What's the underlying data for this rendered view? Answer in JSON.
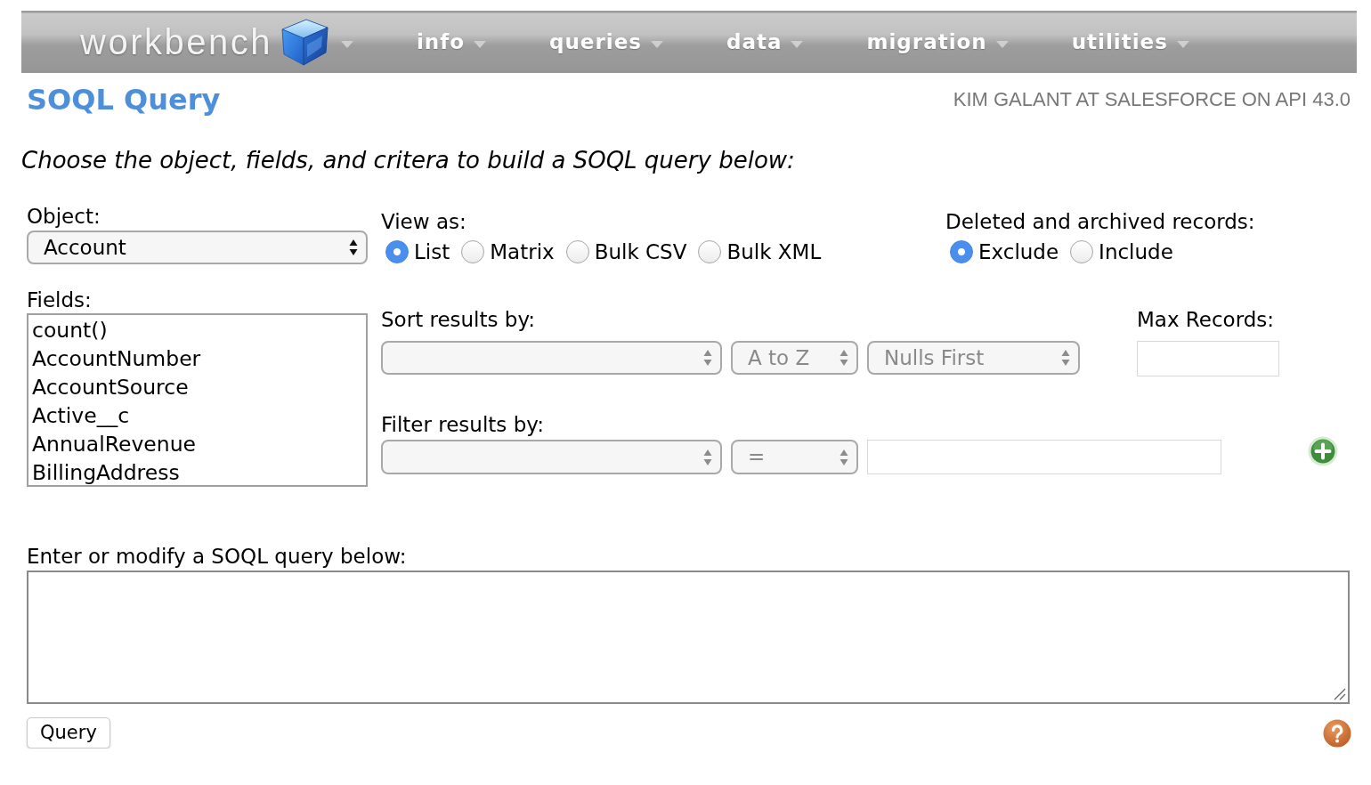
{
  "nav": {
    "logo": "workbench",
    "items": [
      {
        "label": "info"
      },
      {
        "label": "queries"
      },
      {
        "label": "data"
      },
      {
        "label": "migration"
      },
      {
        "label": "utilities"
      }
    ]
  },
  "header": {
    "title": "SOQL Query",
    "connection": "KIM GALANT AT SALESFORCE ON API 43.0"
  },
  "instructions": "Choose the object, fields, and critera to build a SOQL query below:",
  "object": {
    "label": "Object:",
    "value": "Account"
  },
  "view_as": {
    "label": "View as:",
    "options": [
      {
        "label": "List",
        "selected": true
      },
      {
        "label": "Matrix",
        "selected": false
      },
      {
        "label": "Bulk CSV",
        "selected": false
      },
      {
        "label": "Bulk XML",
        "selected": false
      }
    ]
  },
  "deleted_records": {
    "label": "Deleted and archived records:",
    "options": [
      {
        "label": "Exclude",
        "selected": true
      },
      {
        "label": "Include",
        "selected": false
      }
    ]
  },
  "fields": {
    "label": "Fields:",
    "items": [
      {
        "label": "count()",
        "selected": false
      },
      {
        "label": "AccountNumber",
        "selected": false
      },
      {
        "label": "AccountSource",
        "selected": false
      },
      {
        "label": "Active__c",
        "selected": false
      },
      {
        "label": "AnnualRevenue",
        "selected": false
      },
      {
        "label": "BillingAddress",
        "selected": false
      }
    ]
  },
  "sort": {
    "label": "Sort results by:",
    "field": {
      "disabled": true
    },
    "direction": {
      "value": "A to Z",
      "disabled": true
    },
    "nulls": {
      "value": "Nulls First",
      "disabled": true
    }
  },
  "max_records": {
    "label": "Max Records:"
  },
  "filter": {
    "label": "Filter results by:",
    "field": {
      "disabled": true
    },
    "operator": {
      "value": "=",
      "disabled": true
    }
  },
  "query": {
    "label": "Enter or modify a SOQL query below:",
    "button": "Query"
  }
}
